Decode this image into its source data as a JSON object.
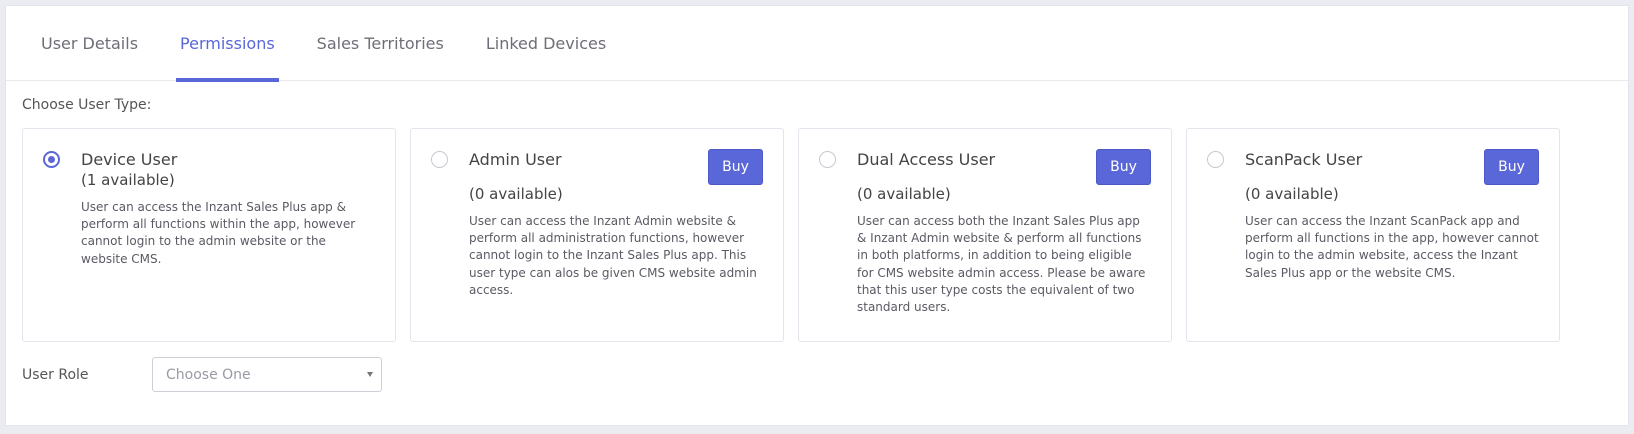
{
  "tabs": [
    {
      "label": "User Details",
      "active": false
    },
    {
      "label": "Permissions",
      "active": true
    },
    {
      "label": "Sales Territories",
      "active": false
    },
    {
      "label": "Linked Devices",
      "active": false
    }
  ],
  "choose_user_type_label": "Choose User Type:",
  "user_types": [
    {
      "title": "Device User",
      "available": "(1 available)",
      "selected": true,
      "buy_label": "",
      "description": "User can access the Inzant Sales Plus app & perform all functions within the app, however cannot login to the admin website or the website CMS."
    },
    {
      "title": "Admin User",
      "available": "(0 available)",
      "selected": false,
      "buy_label": "Buy",
      "description": "User can access the Inzant Admin website & perform all administration functions, however cannot login to the Inzant Sales Plus app. This user type can alos be given CMS website admin access."
    },
    {
      "title": "Dual Access User",
      "available": "(0 available)",
      "selected": false,
      "buy_label": "Buy",
      "description": "User can access both the Inzant Sales Plus app & Inzant Admin website & perform all functions in both platforms, in addition to being eligible for CMS website admin access. Please be aware that this user type costs the equivalent of two standard users."
    },
    {
      "title": "ScanPack User",
      "available": "(0 available)",
      "selected": false,
      "buy_label": "Buy",
      "description": "User can access the Inzant ScanPack app and perform all functions in the app, however cannot login to the admin website, access the Inzant Sales Plus app or the website CMS."
    }
  ],
  "user_role": {
    "label": "User Role",
    "placeholder": "Choose One"
  },
  "colors": {
    "accent": "#5a67d8",
    "background": "#ebebf2"
  }
}
